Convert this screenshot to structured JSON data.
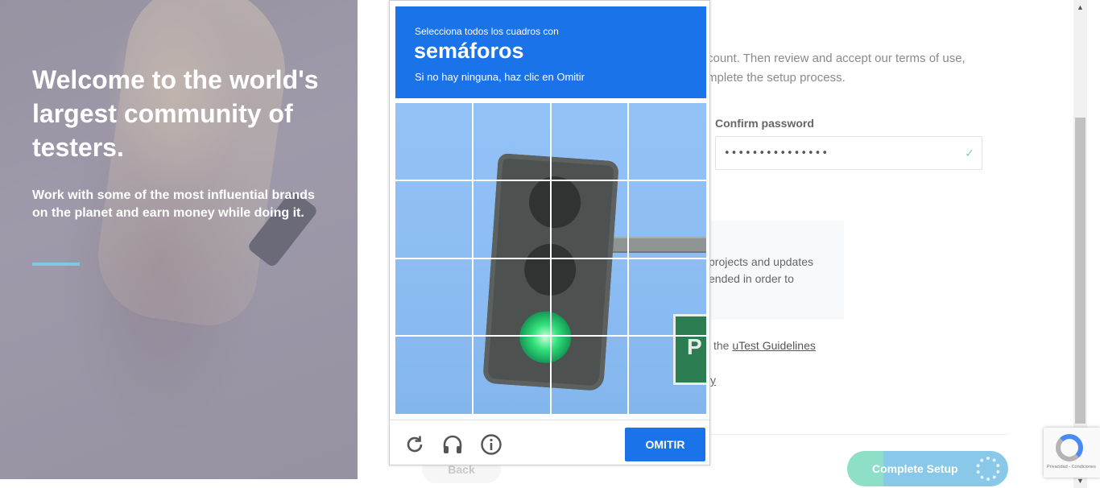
{
  "hero": {
    "title": "Welcome to the world's largest community of testers.",
    "subtitle": "Work with some of the most influential brands on the planet and earn money while doing it."
  },
  "form": {
    "intro_line1": "count. Then review and accept our terms of use,",
    "intro_line2": "mplete the setup process.",
    "confirm_password_label": "Confirm password",
    "confirm_password_value": "•••••••••••••••",
    "info_text_line1": "projects and updates",
    "info_text_line2": "ended in order to",
    "guideline_prefix": "the ",
    "guideline_link": "uTest Guidelines",
    "privacy_tail": "y",
    "back_label": "Back",
    "complete_label": "Complete Setup"
  },
  "captcha": {
    "instruction": "Selecciona todos los cuadros con",
    "keyword": "semáforos",
    "hint": "Si no hay ninguna, haz clic en Omitir",
    "skip_label": "OMITIR",
    "sign_letter": "P"
  },
  "recaptcha_badge": {
    "privacy_text": "Privacidad - Condiciones"
  },
  "colors": {
    "captcha_blue": "#1a73e8",
    "accent_line": "#7ec8e3",
    "complete_btn_green": "#8edfc8",
    "complete_btn_blue": "#8ac8ea"
  },
  "icons": [
    "reload-icon",
    "headphones-icon",
    "info-icon",
    "check-icon",
    "spinner-icon",
    "recaptcha-logo-icon"
  ]
}
